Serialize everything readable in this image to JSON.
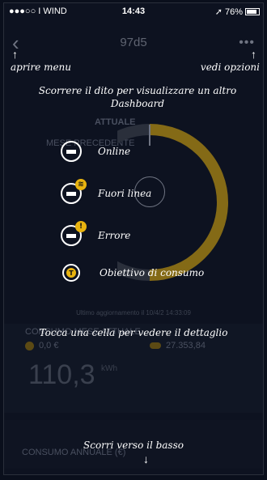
{
  "status": {
    "carrier": "●●●○○ I WIND",
    "time": "14:43",
    "battery": "76%"
  },
  "header": {
    "title": "97d5"
  },
  "hints": {
    "open_menu": "aprire menu",
    "see_options": "vedi opzioni",
    "swipe": "Scorrere il dito per visualizzare un altro Dashboard",
    "tap_cell": "Tocca una cella per vedere il dettaglio",
    "scroll_down": "Scorri verso il basso"
  },
  "dashboard": {
    "current_label": "ATTUALE",
    "previous_label": "MESE PRECEDENTE",
    "last_update": "Ultimo aggiornamento il 10/4/2 14:33:09"
  },
  "legend": [
    {
      "label": "Online",
      "badge": ""
    },
    {
      "label": "Fuori linea",
      "badge": "wifi"
    },
    {
      "label": "Errore",
      "badge": "!"
    },
    {
      "label": "Obiettivo di consumo",
      "badge": "T"
    }
  ],
  "consumption": {
    "current_month_label": "CONSUMO MESE ATTUALE",
    "cost_value": "0,0 €",
    "cloud_value": "27.353,84",
    "big_value": "110,3",
    "unit": "kWh",
    "annual_label": "CONSUMO ANNUALE (€)"
  },
  "colors": {
    "accent": "#e8b30f",
    "background": "#0d1220"
  }
}
